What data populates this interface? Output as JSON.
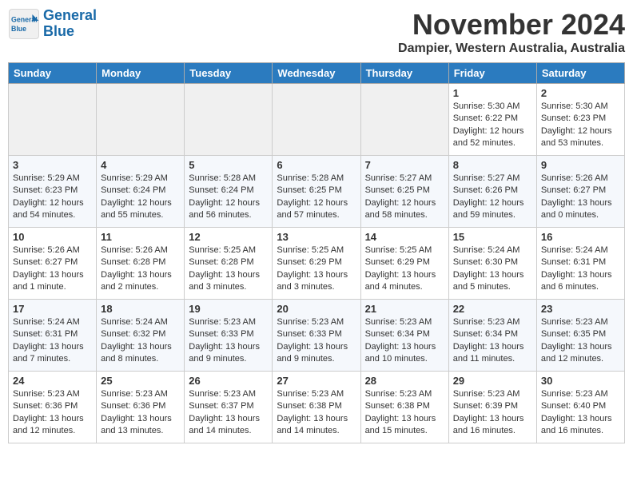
{
  "logo": {
    "text1": "General",
    "text2": "Blue"
  },
  "title": "November 2024",
  "location": "Dampier, Western Australia, Australia",
  "weekdays": [
    "Sunday",
    "Monday",
    "Tuesday",
    "Wednesday",
    "Thursday",
    "Friday",
    "Saturday"
  ],
  "rows": [
    [
      {
        "day": "",
        "info": ""
      },
      {
        "day": "",
        "info": ""
      },
      {
        "day": "",
        "info": ""
      },
      {
        "day": "",
        "info": ""
      },
      {
        "day": "",
        "info": ""
      },
      {
        "day": "1",
        "info": "Sunrise: 5:30 AM\nSunset: 6:22 PM\nDaylight: 12 hours\nand 52 minutes."
      },
      {
        "day": "2",
        "info": "Sunrise: 5:30 AM\nSunset: 6:23 PM\nDaylight: 12 hours\nand 53 minutes."
      }
    ],
    [
      {
        "day": "3",
        "info": "Sunrise: 5:29 AM\nSunset: 6:23 PM\nDaylight: 12 hours\nand 54 minutes."
      },
      {
        "day": "4",
        "info": "Sunrise: 5:29 AM\nSunset: 6:24 PM\nDaylight: 12 hours\nand 55 minutes."
      },
      {
        "day": "5",
        "info": "Sunrise: 5:28 AM\nSunset: 6:24 PM\nDaylight: 12 hours\nand 56 minutes."
      },
      {
        "day": "6",
        "info": "Sunrise: 5:28 AM\nSunset: 6:25 PM\nDaylight: 12 hours\nand 57 minutes."
      },
      {
        "day": "7",
        "info": "Sunrise: 5:27 AM\nSunset: 6:25 PM\nDaylight: 12 hours\nand 58 minutes."
      },
      {
        "day": "8",
        "info": "Sunrise: 5:27 AM\nSunset: 6:26 PM\nDaylight: 12 hours\nand 59 minutes."
      },
      {
        "day": "9",
        "info": "Sunrise: 5:26 AM\nSunset: 6:27 PM\nDaylight: 13 hours\nand 0 minutes."
      }
    ],
    [
      {
        "day": "10",
        "info": "Sunrise: 5:26 AM\nSunset: 6:27 PM\nDaylight: 13 hours\nand 1 minute."
      },
      {
        "day": "11",
        "info": "Sunrise: 5:26 AM\nSunset: 6:28 PM\nDaylight: 13 hours\nand 2 minutes."
      },
      {
        "day": "12",
        "info": "Sunrise: 5:25 AM\nSunset: 6:28 PM\nDaylight: 13 hours\nand 3 minutes."
      },
      {
        "day": "13",
        "info": "Sunrise: 5:25 AM\nSunset: 6:29 PM\nDaylight: 13 hours\nand 3 minutes."
      },
      {
        "day": "14",
        "info": "Sunrise: 5:25 AM\nSunset: 6:29 PM\nDaylight: 13 hours\nand 4 minutes."
      },
      {
        "day": "15",
        "info": "Sunrise: 5:24 AM\nSunset: 6:30 PM\nDaylight: 13 hours\nand 5 minutes."
      },
      {
        "day": "16",
        "info": "Sunrise: 5:24 AM\nSunset: 6:31 PM\nDaylight: 13 hours\nand 6 minutes."
      }
    ],
    [
      {
        "day": "17",
        "info": "Sunrise: 5:24 AM\nSunset: 6:31 PM\nDaylight: 13 hours\nand 7 minutes."
      },
      {
        "day": "18",
        "info": "Sunrise: 5:24 AM\nSunset: 6:32 PM\nDaylight: 13 hours\nand 8 minutes."
      },
      {
        "day": "19",
        "info": "Sunrise: 5:23 AM\nSunset: 6:33 PM\nDaylight: 13 hours\nand 9 minutes."
      },
      {
        "day": "20",
        "info": "Sunrise: 5:23 AM\nSunset: 6:33 PM\nDaylight: 13 hours\nand 9 minutes."
      },
      {
        "day": "21",
        "info": "Sunrise: 5:23 AM\nSunset: 6:34 PM\nDaylight: 13 hours\nand 10 minutes."
      },
      {
        "day": "22",
        "info": "Sunrise: 5:23 AM\nSunset: 6:34 PM\nDaylight: 13 hours\nand 11 minutes."
      },
      {
        "day": "23",
        "info": "Sunrise: 5:23 AM\nSunset: 6:35 PM\nDaylight: 13 hours\nand 12 minutes."
      }
    ],
    [
      {
        "day": "24",
        "info": "Sunrise: 5:23 AM\nSunset: 6:36 PM\nDaylight: 13 hours\nand 12 minutes."
      },
      {
        "day": "25",
        "info": "Sunrise: 5:23 AM\nSunset: 6:36 PM\nDaylight: 13 hours\nand 13 minutes."
      },
      {
        "day": "26",
        "info": "Sunrise: 5:23 AM\nSunset: 6:37 PM\nDaylight: 13 hours\nand 14 minutes."
      },
      {
        "day": "27",
        "info": "Sunrise: 5:23 AM\nSunset: 6:38 PM\nDaylight: 13 hours\nand 14 minutes."
      },
      {
        "day": "28",
        "info": "Sunrise: 5:23 AM\nSunset: 6:38 PM\nDaylight: 13 hours\nand 15 minutes."
      },
      {
        "day": "29",
        "info": "Sunrise: 5:23 AM\nSunset: 6:39 PM\nDaylight: 13 hours\nand 16 minutes."
      },
      {
        "day": "30",
        "info": "Sunrise: 5:23 AM\nSunset: 6:40 PM\nDaylight: 13 hours\nand 16 minutes."
      }
    ]
  ]
}
